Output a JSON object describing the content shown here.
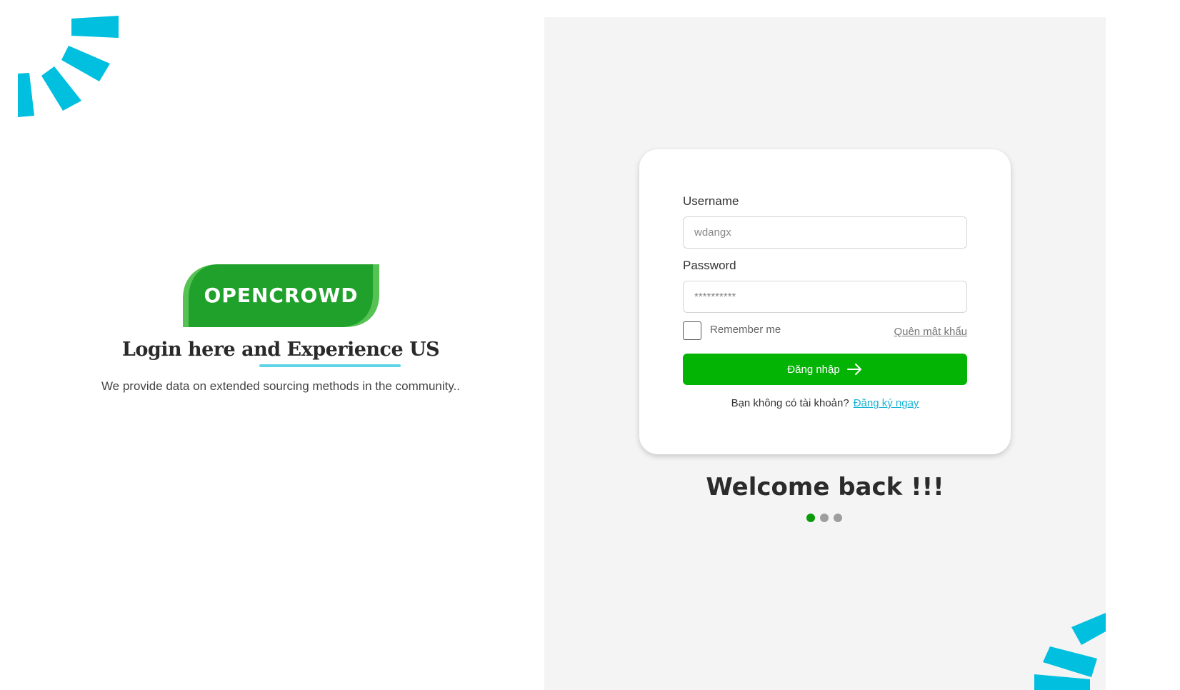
{
  "brand": {
    "logo_text": "OPENCROWD"
  },
  "left": {
    "headline": "Login here and Experience US",
    "tagline": "We provide data on extended sourcing methods in the community.."
  },
  "form": {
    "username_label": "Username",
    "username_value": "wdangx",
    "password_label": "Password",
    "password_value": "**********",
    "remember_label": "Remember me",
    "remember_checked": false,
    "forgot_label": "Quên mật khẩu",
    "login_label": "Đăng nhập",
    "signup_prompt": "Bạn không có tài khoản?",
    "signup_link": "Đăng ký ngay"
  },
  "carousel": {
    "title": "Welcome back !!!",
    "active_index": 0,
    "count": 3
  },
  "icons": {
    "login_arrow": "arrow-right-icon",
    "decoration": "burst-decoration-icon"
  },
  "colors": {
    "primary_green": "#04b404",
    "logo_green": "#1fa12b",
    "accent_cyan": "#00bfdf",
    "link_cyan": "#17b3d4",
    "underline_cyan": "#5dd3e6",
    "panel_gray": "#f4f4f4"
  }
}
